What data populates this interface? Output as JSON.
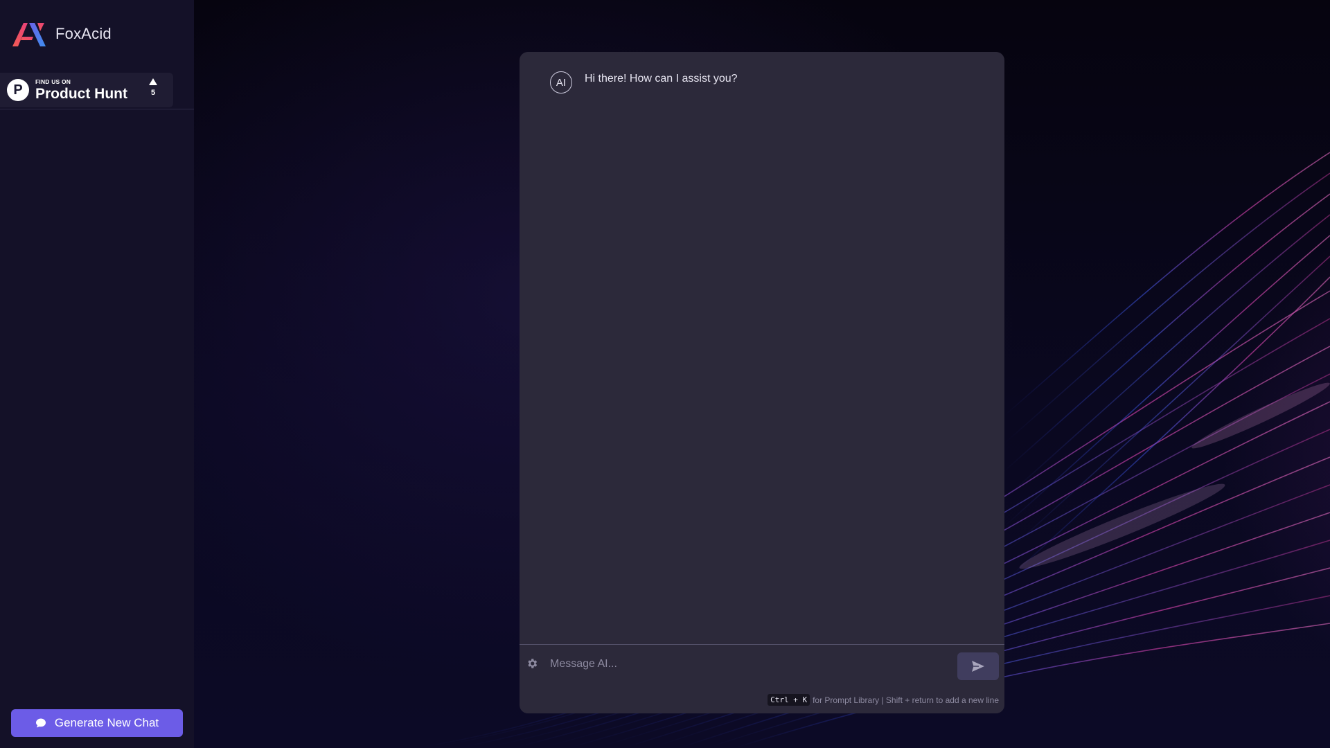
{
  "app": {
    "name": "FoxAcid"
  },
  "sidebar": {
    "product_hunt": {
      "kicker": "FIND US ON",
      "title": "Product Hunt",
      "logo_letter": "P",
      "votes": "5"
    },
    "new_chat_label": "Generate New Chat"
  },
  "chat": {
    "messages": [
      {
        "avatar": "AI",
        "text": "Hi there! How can I assist you?"
      }
    ],
    "input": {
      "value": "",
      "placeholder": "Message AI..."
    },
    "hint": {
      "shortcut": "Ctrl + K",
      "text": "for Prompt Library | Shift + return to add a new line"
    }
  },
  "icons": {
    "logo": "foxacid-logo-icon",
    "chat": "chat-bubble-icon",
    "settings": "gear-icon",
    "send": "send-icon",
    "upvote": "upvote-arrow-icon"
  },
  "colors": {
    "accent": "#6c5ce7",
    "sidebar": "#141128",
    "panel": "#2c293a",
    "send_button": "#403d5e"
  }
}
